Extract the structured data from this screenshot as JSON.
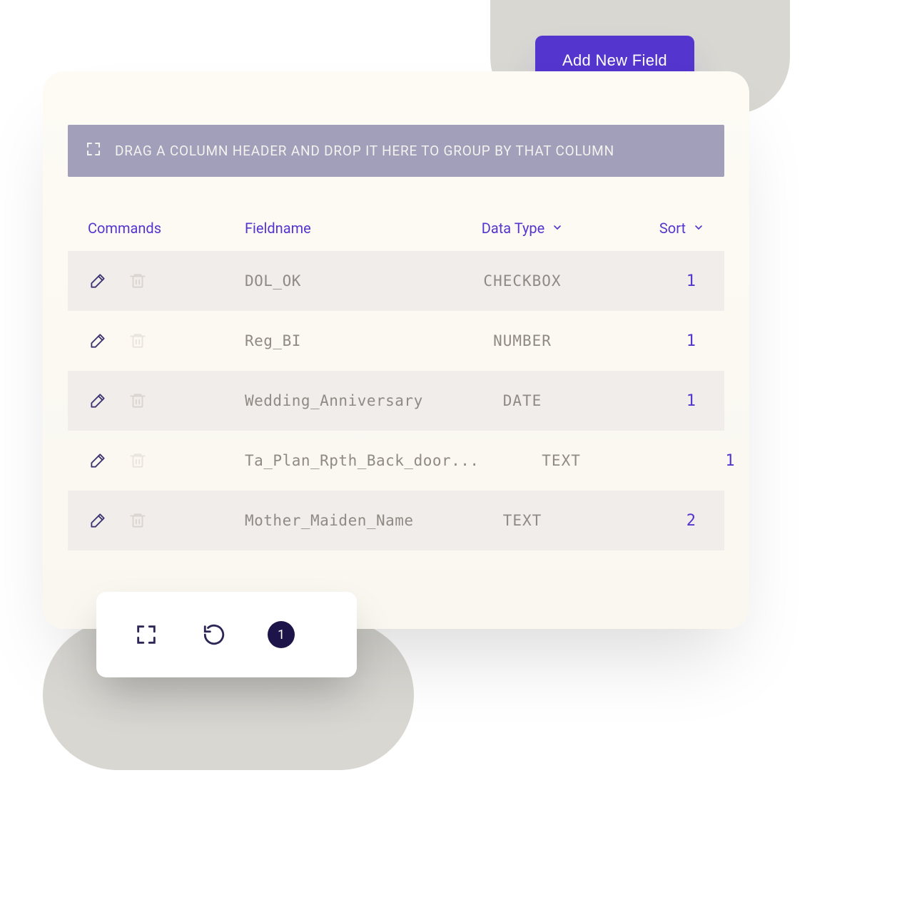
{
  "actions": {
    "add_new_field": "Add New Field"
  },
  "group_bar": {
    "text": "DRAG A COLUMN HEADER AND DROP IT HERE TO GROUP BY THAT COLUMN"
  },
  "table": {
    "headers": {
      "commands": "Commands",
      "fieldname": "Fieldname",
      "datatype": "Data Type",
      "sort": "Sort"
    },
    "rows": [
      {
        "fieldname": "DOL_OK",
        "datatype": "CHECKBOX",
        "sort": "1"
      },
      {
        "fieldname": "Reg_BI",
        "datatype": "NUMBER",
        "sort": "1"
      },
      {
        "fieldname": "Wedding_Anniversary",
        "datatype": "DATE",
        "sort": "1"
      },
      {
        "fieldname": "Ta_Plan_Rpth_Back_door...",
        "datatype": "TEXT",
        "sort": "1"
      },
      {
        "fieldname": "Mother_Maiden_Name",
        "datatype": "TEXT",
        "sort": "2"
      }
    ]
  },
  "toolbar": {
    "page": "1"
  },
  "icons": {
    "edit": "edit-icon",
    "trash": "trash-icon",
    "expand": "expand-icon",
    "refresh": "refresh-icon",
    "chevron": "chevron-down-icon"
  },
  "colors": {
    "primary": "#5435cd",
    "muted": "#8f8a84",
    "badge": "#1d1549"
  }
}
